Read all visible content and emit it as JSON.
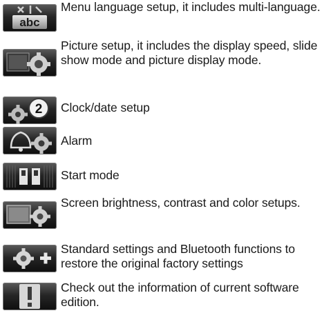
{
  "items": [
    {
      "icon": "language-icon",
      "text": "Menu language setup, it includes multi-language."
    },
    {
      "icon": "picture-setup-icon",
      "text": "Picture setup, it includes the display speed, slide show mode and picture display mode."
    },
    {
      "icon": "clock-gear-icon",
      "text": "Clock/date setup"
    },
    {
      "icon": "alarm-bell-icon",
      "text": "Alarm"
    },
    {
      "icon": "start-mode-icon",
      "text": "Start mode"
    },
    {
      "icon": "screen-brightness-icon",
      "text": "Screen brightness, contrast and color setups."
    },
    {
      "icon": "standard-settings-icon",
      "text": "Standard settings and Bluetooth functions to restore the original factory settings"
    },
    {
      "icon": "info-exclamation-icon",
      "text": "Check out the information of current software edition."
    }
  ]
}
